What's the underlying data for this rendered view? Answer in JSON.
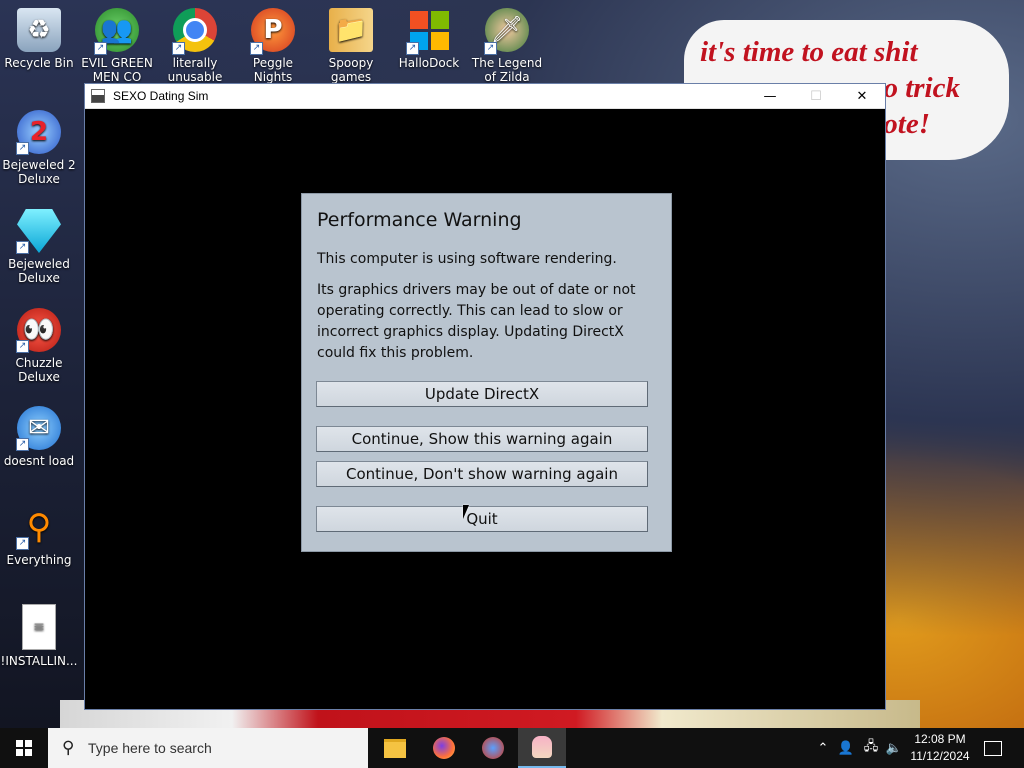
{
  "desktop": {
    "wallpaper_text": {
      "line1": "it's time to eat shit",
      "line2": "go trick",
      "line3": "vote!"
    },
    "icons": [
      {
        "label": "Recycle Bin",
        "icon": "recycle-bin-icon"
      },
      {
        "label": "EVIL GREEN MEN CO",
        "icon": "green-men-icon"
      },
      {
        "label": "literally unusable",
        "icon": "chrome-icon"
      },
      {
        "label": "Peggle Nights Deluxe",
        "icon": "peggle-icon"
      },
      {
        "label": "Spoopy games",
        "icon": "spoopy-folder-icon"
      },
      {
        "label": "HalloDock",
        "icon": "windows-logo-icon"
      },
      {
        "label": "The Legend of Zilda",
        "icon": "zilda-icon"
      },
      {
        "label": "Bejeweled 2 Deluxe",
        "icon": "bejeweled2-icon"
      },
      {
        "label": "Bejeweled Deluxe",
        "icon": "bejeweled-icon"
      },
      {
        "label": "Chuzzle Deluxe",
        "icon": "chuzzle-icon"
      },
      {
        "label": "doesnt load",
        "icon": "thunderbird-icon"
      },
      {
        "label": "Everything",
        "icon": "everything-search-icon"
      },
      {
        "label": "!INSTALLIN...",
        "icon": "text-file-icon"
      }
    ]
  },
  "window": {
    "title": "SEXO Dating Sim",
    "minimize": "—",
    "maximize": "☐",
    "close": "✕"
  },
  "dialog": {
    "title": "Performance Warning",
    "paragraph1": "This computer is using software rendering.",
    "paragraph2": "Its graphics drivers may be out of date or not operating correctly. This can lead to slow or incorrect graphics display. Updating DirectX could fix this problem.",
    "buttons": {
      "update": "Update DirectX",
      "continue_show": "Continue, Show this warning again",
      "continue_dont_show": "Continue, Don't show warning again",
      "quit": "Quit"
    }
  },
  "taskbar": {
    "search_placeholder": "Type here to search",
    "clock_time": "12:08 PM",
    "clock_date": "11/12/2024"
  },
  "colors": {
    "dialog_bg": "#b9c4cf",
    "taskbar_bg": "#101010",
    "wallpaper_text": "#c1121f"
  }
}
